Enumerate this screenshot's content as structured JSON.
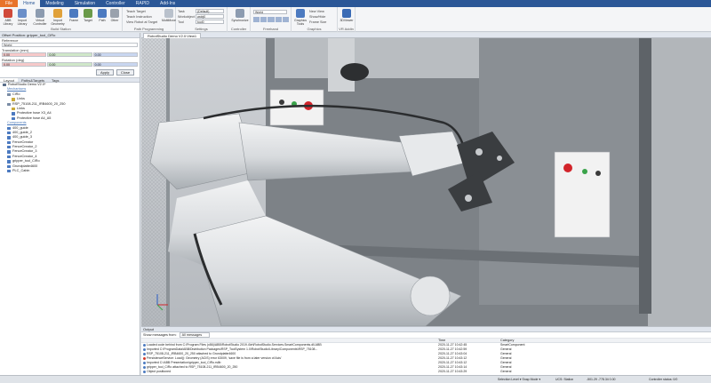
{
  "ribbon_tabs": [
    "File",
    "Home",
    "Modeling",
    "Simulation",
    "Controller",
    "RAPID",
    "Add-Ins"
  ],
  "ribbon": {
    "build_station": {
      "label": "Build Station",
      "buttons": [
        "ABB Library",
        "Import Library",
        "Virtual Controller",
        "Import Geometry",
        "Frame",
        "Target",
        "Path",
        "Other"
      ]
    },
    "path_programming": {
      "label": "Path Programming",
      "items": [
        "Teach Target",
        "Teach Instruction",
        "View Robot at Target"
      ],
      "multimove": "MultiMove"
    },
    "settings": {
      "label": "Settings",
      "rows": [
        {
          "name": "Task",
          "value": "(Default)"
        },
        {
          "name": "Workobject",
          "value": "wobj0"
        },
        {
          "name": "Tool",
          "value": "tool0"
        }
      ]
    },
    "controller": {
      "label": "Controller",
      "button": "Synchronize"
    },
    "freehand": {
      "label": "Freehand",
      "value": "World"
    },
    "graphics": {
      "label": "Graphics",
      "button": "Graphics Tools",
      "items": [
        "New View",
        "Show/Hide",
        "Frame Size"
      ]
    },
    "vr": {
      "label": "VR Addin",
      "button": "3DViewer"
    }
  },
  "offset_panel": {
    "title": "Offset Position: gripper_tool_CiRo",
    "reference_label": "Reference",
    "reference_value": "World",
    "translation_label": "Translation (mm)",
    "translation": [
      "0.00",
      "0.00",
      "0.00"
    ],
    "rotation_label": "Rotation (deg)",
    "rotation": [
      "0.00",
      "0.00",
      "0.00"
    ],
    "apply": "Apply",
    "close": "Close"
  },
  "layout_tabs": [
    "Layout",
    "Paths&Targets",
    "Tags"
  ],
  "tree": [
    {
      "text": "RobotStudio Demo V2.0*",
      "level": 0,
      "color": "#5a6e8a"
    },
    {
      "text": "Mechanisms",
      "level": 1,
      "header": true
    },
    {
      "text": "CiRo",
      "level": 1,
      "color": "#7a8ca5"
    },
    {
      "text": "Links",
      "level": 2,
      "color": "#c9a93a"
    },
    {
      "text": "RSP_75108-211_IRB4600_20_250",
      "level": 1,
      "color": "#7a8ca5"
    },
    {
      "text": "Links",
      "level": 2,
      "color": "#c9a93a"
    },
    {
      "text": "Protective hose X3_A4",
      "level": 2,
      "color": "#4c7ac0"
    },
    {
      "text": "Protective hose A4_A5",
      "level": 2,
      "color": "#4c7ac0"
    },
    {
      "text": "Components",
      "level": 1,
      "header": true
    },
    {
      "text": "400_guide",
      "level": 1,
      "color": "#4c7ac0"
    },
    {
      "text": "400_guide_2",
      "level": 1,
      "color": "#4c7ac0"
    },
    {
      "text": "400_guide_3",
      "level": 1,
      "color": "#4c7ac0"
    },
    {
      "text": "FenceCreator",
      "level": 1,
      "color": "#4c7ac0"
    },
    {
      "text": "FenceCreator_2",
      "level": 1,
      "color": "#4c7ac0"
    },
    {
      "text": "FenceCreator_3",
      "level": 1,
      "color": "#4c7ac0"
    },
    {
      "text": "FenceCreator_4",
      "level": 1,
      "color": "#4c7ac0"
    },
    {
      "text": "gripper_tool_CiRo",
      "level": 1,
      "color": "#4c7ac0"
    },
    {
      "text": "Grundplatte4600",
      "level": 1,
      "color": "#4c7ac0"
    },
    {
      "text": "PLC_Cabin",
      "level": 1,
      "color": "#4c7ac0"
    }
  ],
  "viewport_tab": "RobotStudio Demo V2.0:View1",
  "output": {
    "title": "Output",
    "filter_label": "Show messages from:",
    "filter_value": "All messages",
    "columns": [
      "",
      "Time",
      "Category"
    ],
    "rows": [
      {
        "msg": "Loaded code behind from C:\\Program Files (x86)\\ABB\\RobotStudio 2019.4\\in\\RobotStudio.Services.SmartComponents.dll.ABB",
        "time": "2020-11-27 10:42:45",
        "cat": "SmartComponent",
        "color": "#4c7ac0"
      },
      {
        "msg": "Imported C:\\ProgramData\\ABB\\Distribution Packages\\RSP_ToolSystem 1.0\\RobotStudio\\Library\\Components\\RSP_75108...",
        "time": "2020-11-27 10:42:59",
        "cat": "General",
        "color": "#4c7ac0"
      },
      {
        "msg": "RSP_75108-211_IRB4600_20_250 attached to Grundplatte4600",
        "time": "2020-11-27 10:43:04",
        "cat": "General",
        "color": "#4c7ac0"
      },
      {
        "msg": "PersistenceService: Load(): Geometry (ACIS) error 63009, 'save file is from a later version of Acis'",
        "time": "2020-11-27 10:43:12",
        "cat": "General",
        "color": "#d23a2a"
      },
      {
        "msg": "Imported C:\\ABB Presentation\\gripper_tool_CiRo.rslib",
        "time": "2020-11-27 10:43:12",
        "cat": "General",
        "color": "#4c7ac0"
      },
      {
        "msg": "gripper_tool_CiRo attached to RSP_75108-211_IRB4600_20_250",
        "time": "2020-11-27 10:43:14",
        "cat": "General",
        "color": "#4c7ac0"
      },
      {
        "msg": "Object positioned",
        "time": "2020-11-27 10:43:29",
        "cat": "General",
        "color": "#4c7ac0"
      }
    ]
  },
  "status": {
    "selection": "Selection Level ▾  Snap Mode ▾",
    "ucs": "UCS: Station",
    "coords": "-501.29  -778.34  0.00",
    "right": "Controller status: 0/0"
  },
  "colors": {
    "ribbon_blue": "#2b5797",
    "file_tab": "#e8732a",
    "x_field": "#f6c9c9",
    "y_field": "#cfe7c9",
    "z_field": "#c9d6f0"
  }
}
